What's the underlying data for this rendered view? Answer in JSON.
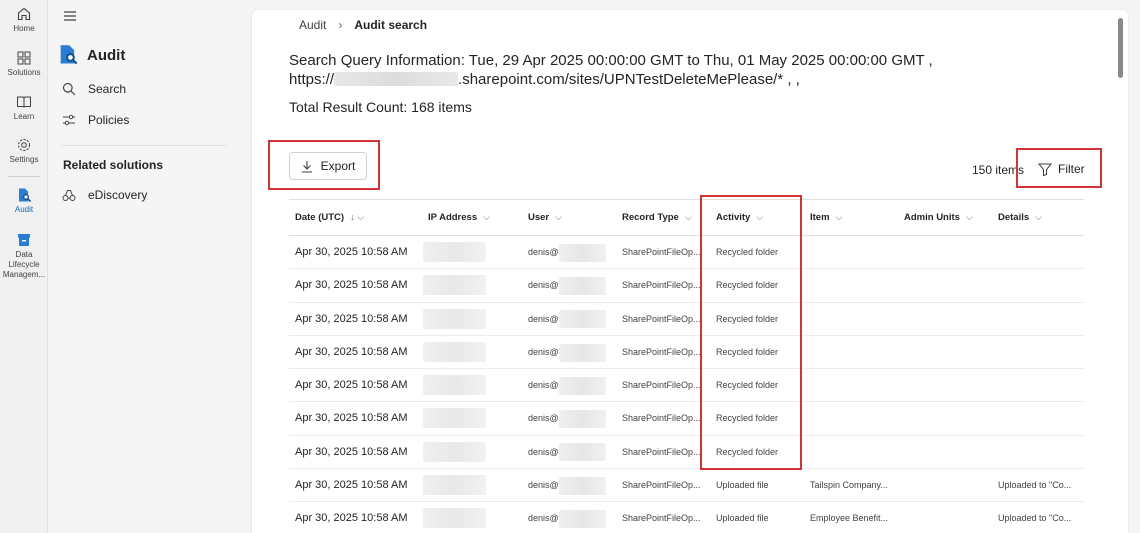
{
  "rail": {
    "items": [
      {
        "label": "Home",
        "icon": "home-icon"
      },
      {
        "label": "Solutions",
        "icon": "grid-icon"
      },
      {
        "label": "Learn",
        "icon": "book-icon"
      },
      {
        "label": "Settings",
        "icon": "gear-icon"
      },
      {
        "label": "Audit",
        "icon": "audit-icon",
        "active": true
      },
      {
        "label": "Data Lifecycle Managem...",
        "icon": "archive-icon"
      }
    ]
  },
  "nav": {
    "app_title": "Audit",
    "items": [
      {
        "label": "Search",
        "icon": "search-icon"
      },
      {
        "label": "Policies",
        "icon": "sliders-icon"
      }
    ],
    "related_heading": "Related solutions",
    "related": [
      {
        "label": "eDiscovery",
        "icon": "ediscovery-icon"
      }
    ]
  },
  "breadcrumb": {
    "parent": "Audit",
    "current": "Audit search"
  },
  "query": {
    "line1": "Search Query Information: Tue, 29 Apr 2025 00:00:00 GMT to Thu, 01 May 2025 00:00:00 GMT ,",
    "line2_prefix": "https://",
    "line2_suffix": ".sharepoint.com/sites/UPNTestDeleteMePlease/* , ,"
  },
  "total": "Total Result Count: 168 items",
  "toolbar": {
    "export_label": "Export",
    "items_count": "150 items",
    "filter_label": "Filter"
  },
  "table": {
    "columns": [
      "Date (UTC)",
      "IP Address",
      "User",
      "Record Type",
      "Activity",
      "Item",
      "Admin Units",
      "Details"
    ],
    "rows": [
      {
        "date": "Apr 30, 2025 10:58 AM",
        "user": "denis@",
        "record_type": "SharePointFileOp...",
        "activity": "Recycled folder",
        "item": "",
        "admin_units": "",
        "details": ""
      },
      {
        "date": "Apr 30, 2025 10:58 AM",
        "user": "denis@",
        "record_type": "SharePointFileOp...",
        "activity": "Recycled folder",
        "item": "",
        "admin_units": "",
        "details": ""
      },
      {
        "date": "Apr 30, 2025 10:58 AM",
        "user": "denis@",
        "record_type": "SharePointFileOp...",
        "activity": "Recycled folder",
        "item": "",
        "admin_units": "",
        "details": ""
      },
      {
        "date": "Apr 30, 2025 10:58 AM",
        "user": "denis@",
        "record_type": "SharePointFileOp...",
        "activity": "Recycled folder",
        "item": "",
        "admin_units": "",
        "details": ""
      },
      {
        "date": "Apr 30, 2025 10:58 AM",
        "user": "denis@",
        "record_type": "SharePointFileOp...",
        "activity": "Recycled folder",
        "item": "",
        "admin_units": "",
        "details": ""
      },
      {
        "date": "Apr 30, 2025 10:58 AM",
        "user": "denis@",
        "record_type": "SharePointFileOp...",
        "activity": "Recycled folder",
        "item": "",
        "admin_units": "",
        "details": ""
      },
      {
        "date": "Apr 30, 2025 10:58 AM",
        "user": "denis@",
        "record_type": "SharePointFileOp...",
        "activity": "Recycled folder",
        "item": "",
        "admin_units": "",
        "details": ""
      },
      {
        "date": "Apr 30, 2025 10:58 AM",
        "user": "denis@",
        "record_type": "SharePointFileOp...",
        "activity": "Uploaded file",
        "item": "Tailspin Company...",
        "admin_units": "",
        "details": "Uploaded to \"Co..."
      },
      {
        "date": "Apr 30, 2025 10:58 AM",
        "user": "denis@",
        "record_type": "SharePointFileOp...",
        "activity": "Uploaded file",
        "item": "Employee Benefit...",
        "admin_units": "",
        "details": "Uploaded to \"Co..."
      }
    ]
  },
  "colors": {
    "accent": "#0f6cbd",
    "highlight_box": "#d13438"
  }
}
